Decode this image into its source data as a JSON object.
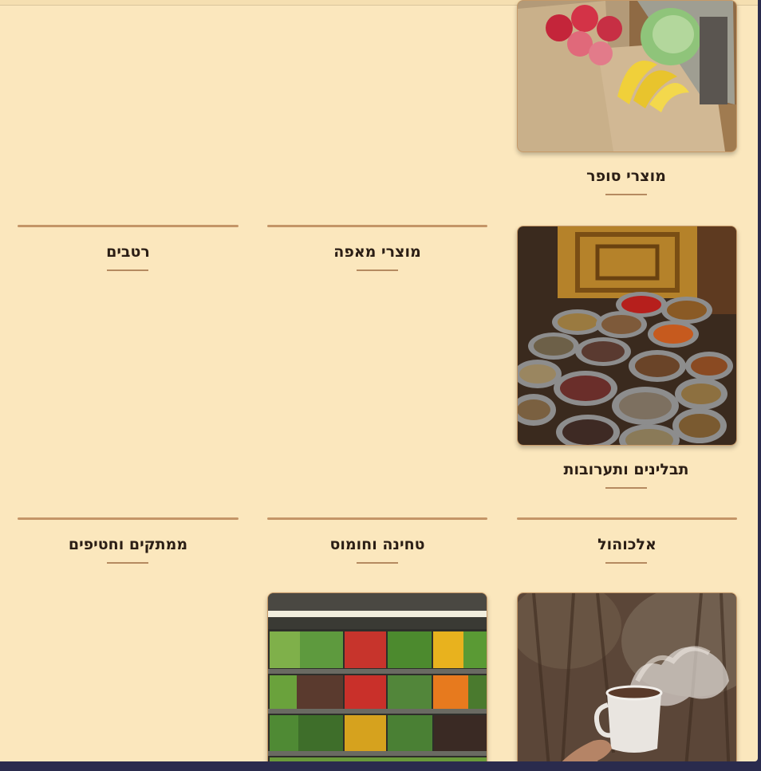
{
  "categories": [
    {
      "label": "מוצרי סופר",
      "image": "grocery-bags-photo"
    },
    {
      "label": "תבלינים ותערובות",
      "image": "spice-bowls-photo"
    },
    {
      "label": "מוצרי מאפה",
      "image": ""
    },
    {
      "label": "רטבים",
      "image": ""
    },
    {
      "label": "אלכוהול",
      "image": "coffee-cup-photo"
    },
    {
      "label": "טחינה וחומוס",
      "image": "vegetable-shelves-photo"
    },
    {
      "label": "ממתקים וחטיפים",
      "image": ""
    }
  ],
  "colors": {
    "background": "#fbe7bd",
    "accent": "#c49567",
    "text": "#2b1e15",
    "outer": "#2a2b4d"
  }
}
